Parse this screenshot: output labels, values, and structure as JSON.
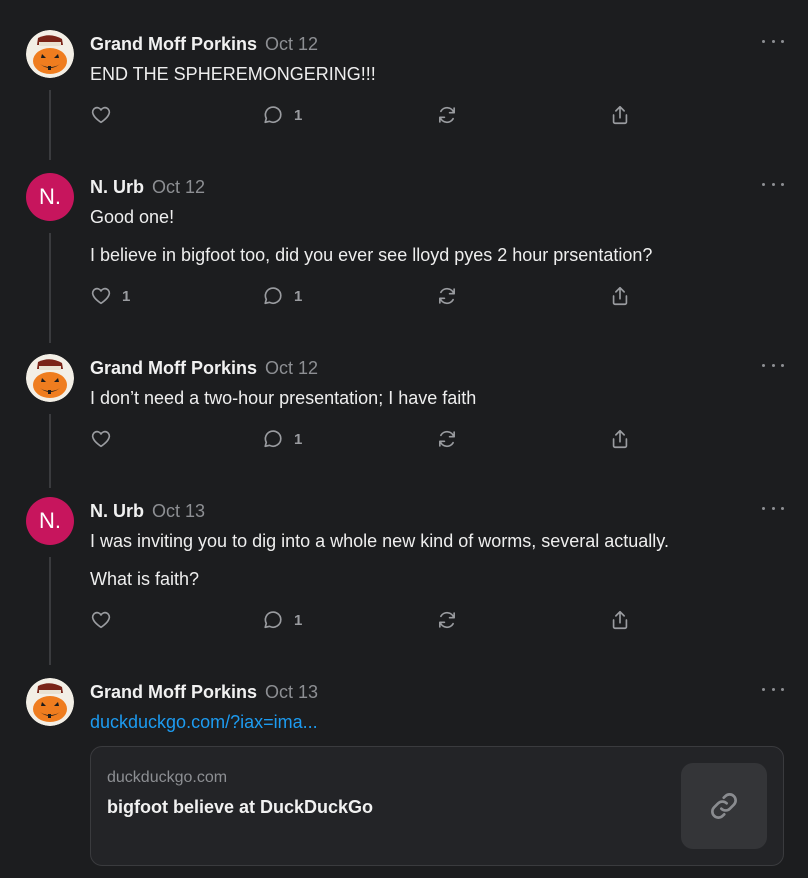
{
  "posts": [
    {
      "author": "Grand Moff Porkins",
      "date": "Oct 12",
      "avatar": "pumpkin-avatar",
      "paragraphs": [
        "END THE SPHEREMONGERING!!!"
      ],
      "likes": "",
      "replies": "1"
    },
    {
      "author": "N. Urb",
      "date": "Oct 12",
      "avatar_letter": "N.",
      "avatar_color": "#c7155d",
      "paragraphs": [
        "Good one!",
        "I believe in bigfoot too, did you ever see lloyd pyes 2 hour prsentation?"
      ],
      "likes": "1",
      "replies": "1"
    },
    {
      "author": "Grand Moff Porkins",
      "date": "Oct 12",
      "avatar": "pumpkin-avatar",
      "paragraphs": [
        "I don’t need a two-hour presentation; I have faith"
      ],
      "likes": "",
      "replies": "1"
    },
    {
      "author": "N. Urb",
      "date": "Oct 13",
      "avatar_letter": "N.",
      "avatar_color": "#c7155d",
      "paragraphs": [
        "I was inviting you to dig into a whole new kind of worms, several actually.",
        "What is faith?"
      ],
      "likes": "",
      "replies": "1"
    },
    {
      "author": "Grand Moff Porkins",
      "date": "Oct 13",
      "avatar": "pumpkin-avatar",
      "link": "duckduckgo.com/?iax=ima...",
      "card": {
        "domain": "duckduckgo.com",
        "title": "bigfoot believe at DuckDuckGo",
        "thumb_icon": "link-icon"
      }
    }
  ],
  "icons": {
    "like": "heart-icon",
    "reply": "comment-icon",
    "restack": "repost-icon",
    "share": "share-icon",
    "more": "more-dots-icon"
  },
  "colors": {
    "background": "#1c1d1f",
    "link": "#1d9bf0",
    "avatar_n": "#c7155d"
  }
}
